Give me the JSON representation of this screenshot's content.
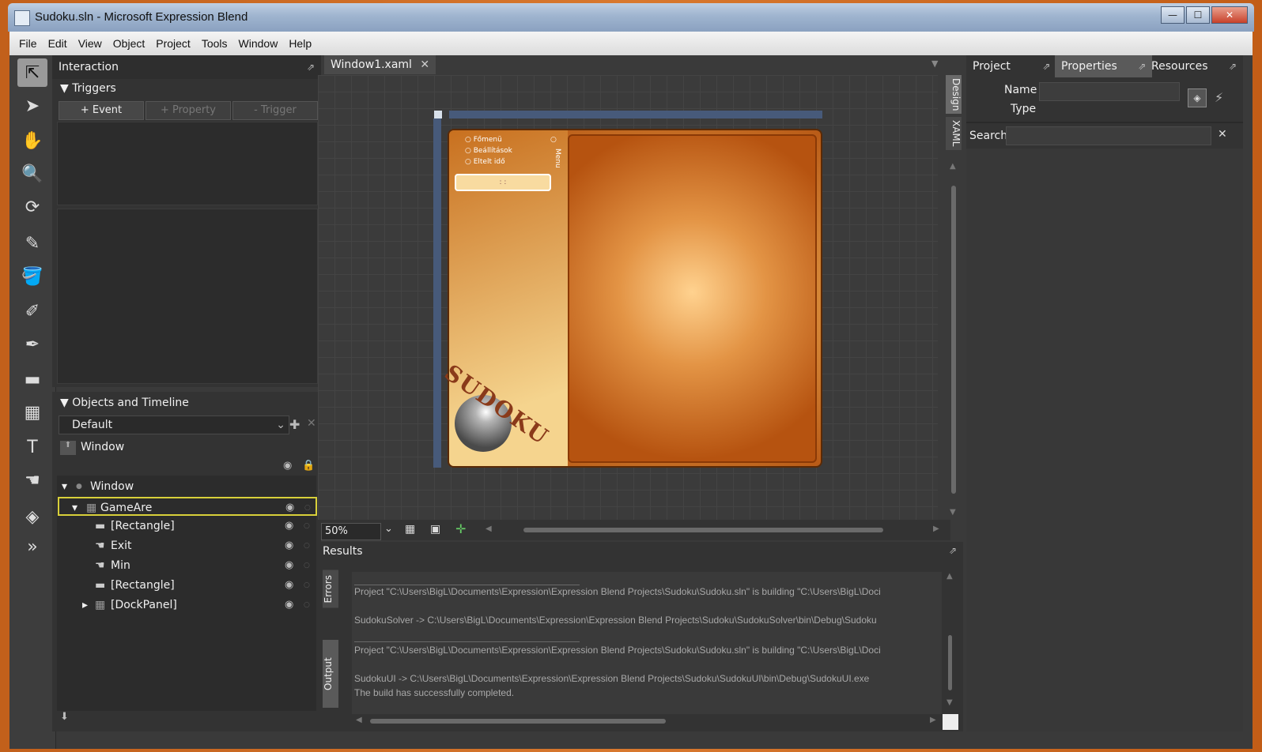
{
  "window": {
    "title": "Sudoku.sln - Microsoft Expression Blend",
    "minimize": "—",
    "maximize": "☐",
    "close": "✕"
  },
  "menubar": [
    "File",
    "Edit",
    "View",
    "Object",
    "Project",
    "Tools",
    "Window",
    "Help"
  ],
  "interaction": {
    "title": "Interaction",
    "triggers_label": "Triggers",
    "buttons": {
      "event": "+ Event",
      "property": "+ Property",
      "trigger": "- Trigger"
    }
  },
  "objects": {
    "title": "Objects and Timeline",
    "storyboard": "Default",
    "scope": "Window",
    "tree": [
      {
        "label": "Window"
      },
      {
        "label": "GameAre"
      },
      {
        "label": "[Rectangle]"
      },
      {
        "label": "Exit"
      },
      {
        "label": "Min"
      },
      {
        "label": "[Rectangle]"
      },
      {
        "label": "[DockPanel]"
      }
    ]
  },
  "document": {
    "tab": "Window1.xaml",
    "design_tab": "Design",
    "xaml_tab": "XAML",
    "zoom": "50%",
    "artboard": {
      "menu_items": [
        "Főmenü",
        "Beállítások",
        "Eltelt idő"
      ],
      "time_display": ": :",
      "menu_label": "Menu",
      "logo": "SUDOKU"
    }
  },
  "results": {
    "title": "Results",
    "tabs": {
      "errors": "Errors",
      "output": "Output"
    },
    "lines": [
      "Project \"C:\\Users\\BigL\\Documents\\Expression\\Expression Blend Projects\\Sudoku\\Sudoku.sln\" is building \"C:\\Users\\BigL\\Doci",
      "SudokuSolver -> C:\\Users\\BigL\\Documents\\Expression\\Expression Blend Projects\\Sudoku\\SudokuSolver\\bin\\Debug\\Sudoku",
      "Project \"C:\\Users\\BigL\\Documents\\Expression\\Expression Blend Projects\\Sudoku\\Sudoku.sln\" is building \"C:\\Users\\BigL\\Doci",
      "SudokuUI -> C:\\Users\\BigL\\Documents\\Expression\\Expression Blend Projects\\Sudoku\\SudokuUI\\bin\\Debug\\SudokuUI.exe",
      "The build has successfully completed."
    ]
  },
  "right": {
    "tabs": [
      "Project",
      "Properties",
      "Resources"
    ],
    "name_label": "Name",
    "type_label": "Type",
    "search_label": "Search",
    "search_value": ""
  }
}
